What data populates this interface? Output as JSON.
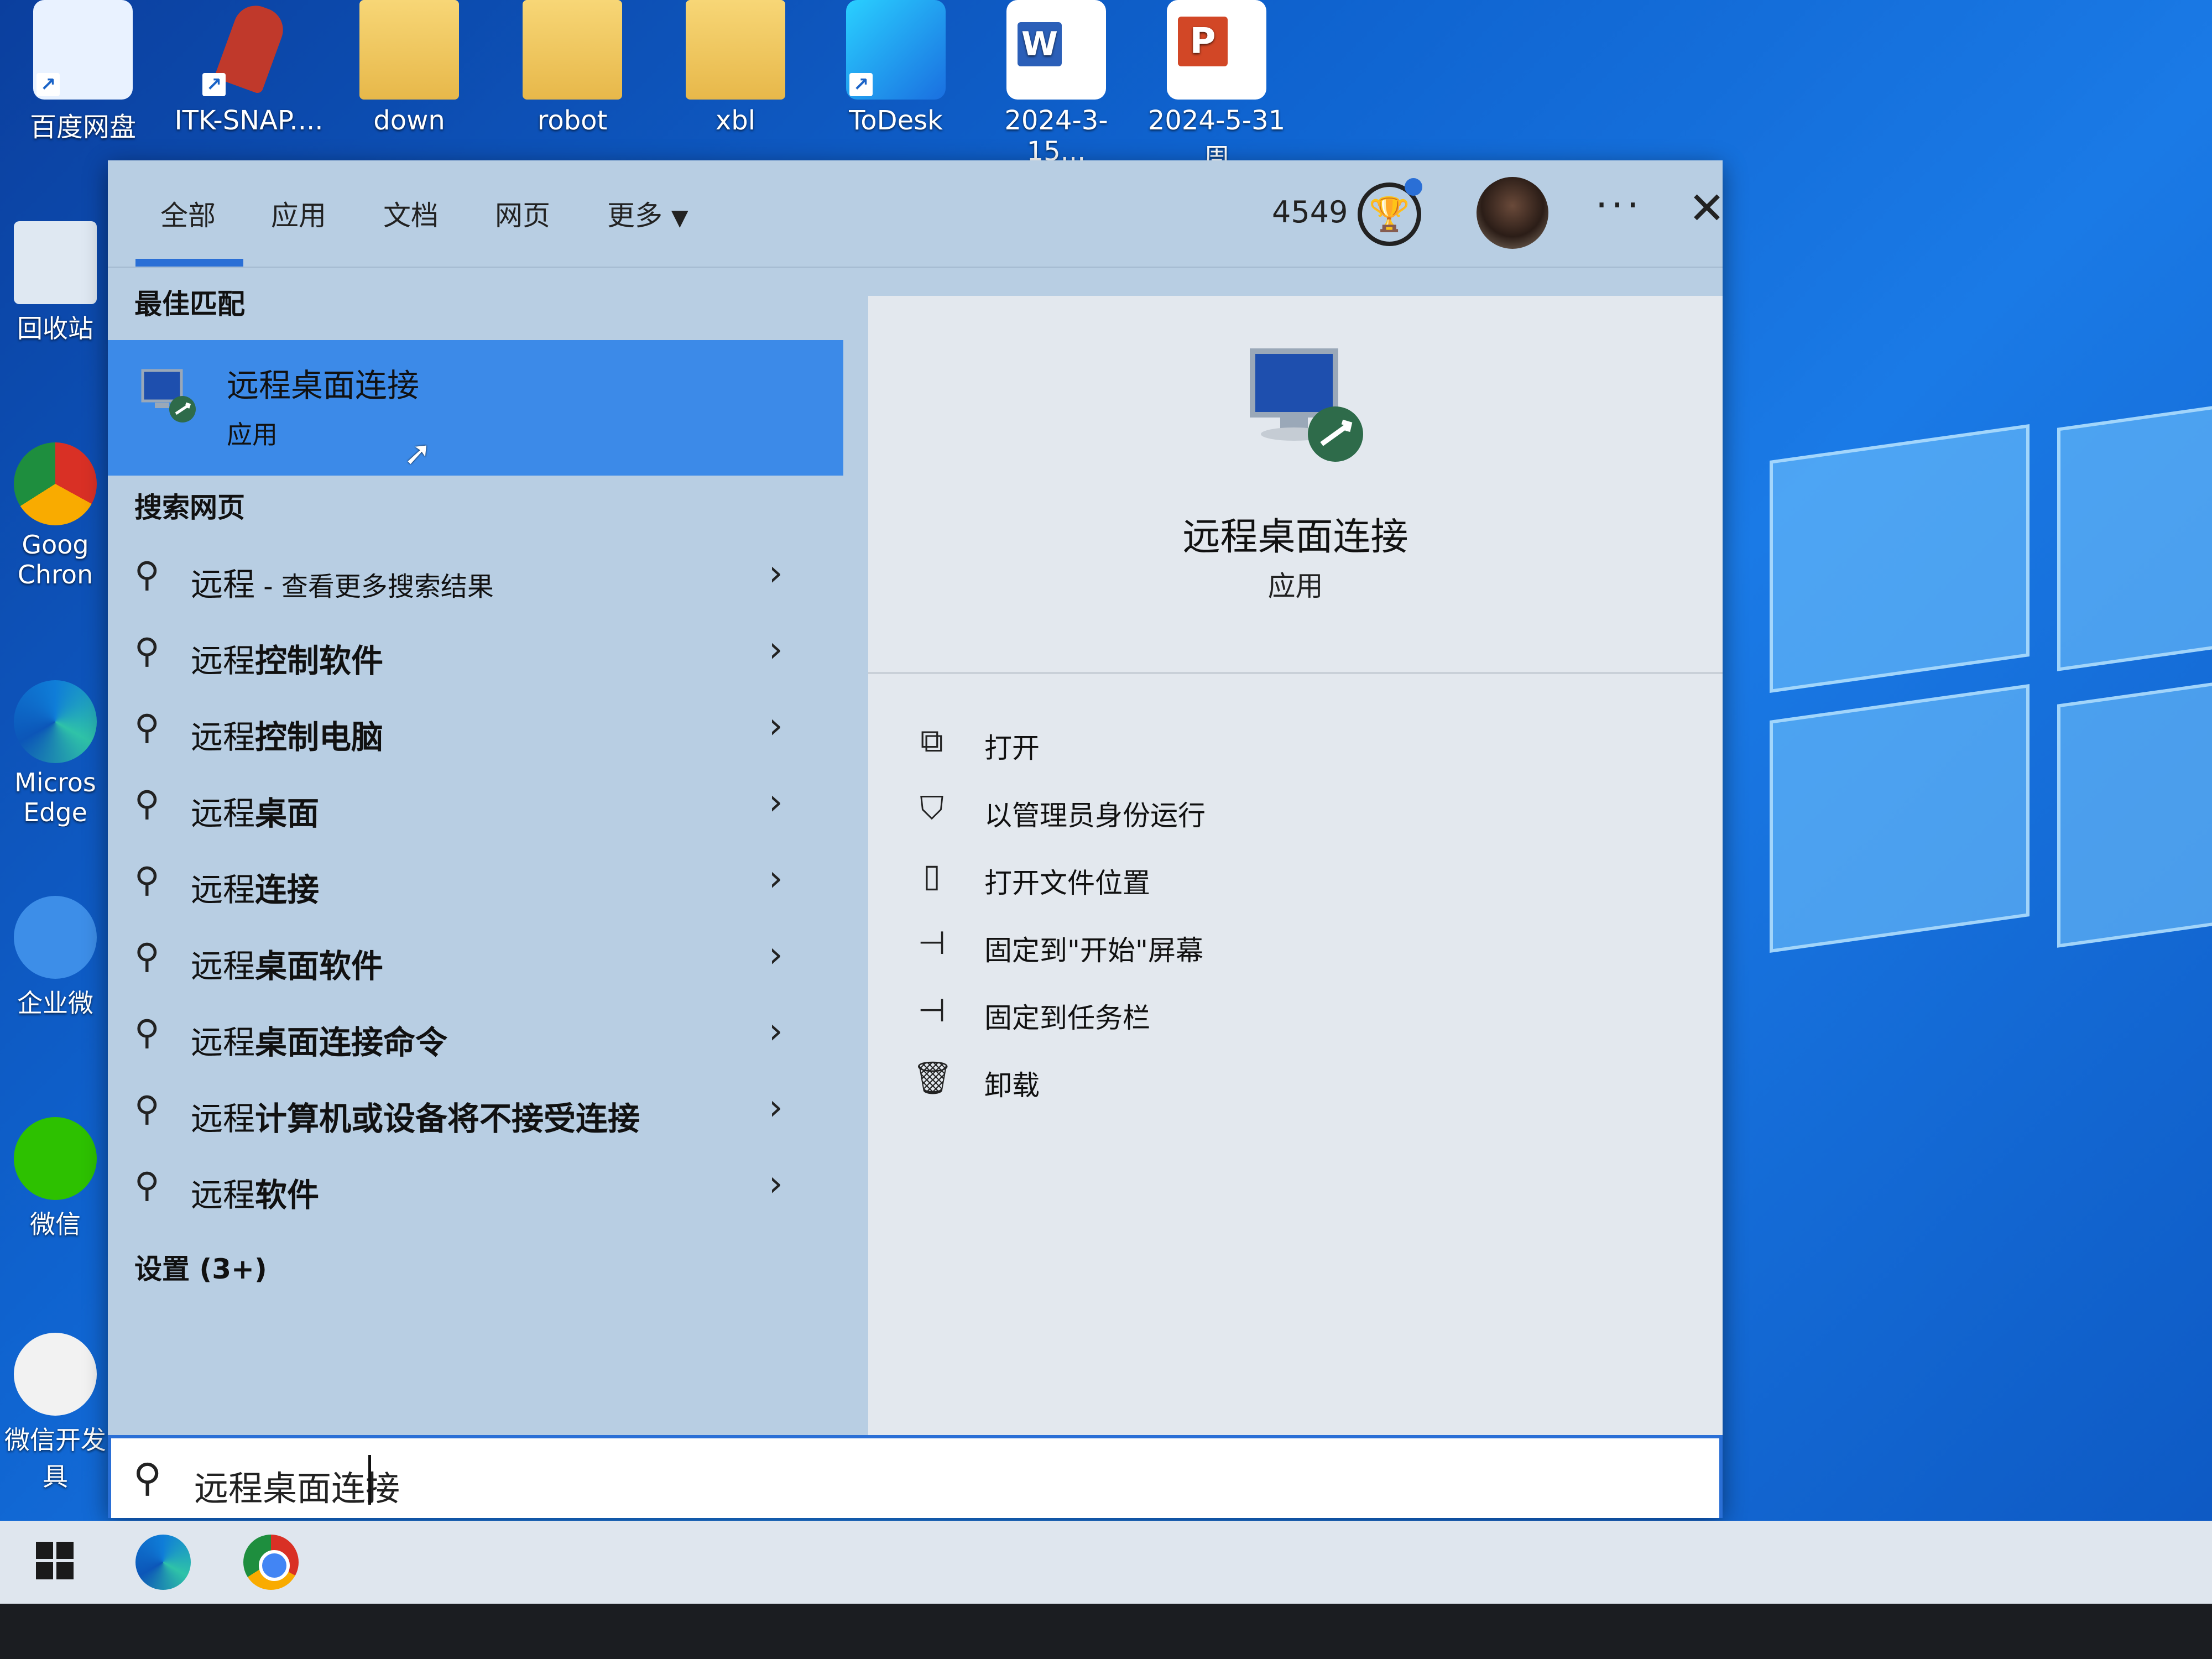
{
  "desktop": {
    "top_icons": [
      {
        "label": "百度网盘"
      },
      {
        "label": "ITK-SNAP...."
      },
      {
        "label": "down"
      },
      {
        "label": "robot"
      },
      {
        "label": "xbl"
      },
      {
        "label": "ToDesk"
      },
      {
        "label": "2024-3-15..."
      },
      {
        "label": "2024-5-31周"
      }
    ],
    "left_icons": [
      {
        "label": "回收站"
      },
      {
        "label": "Goog Chron"
      },
      {
        "label": "Micros Edge"
      },
      {
        "label": "企业微"
      },
      {
        "label": "微信"
      },
      {
        "label": "微信开发具"
      }
    ]
  },
  "search_panel": {
    "tabs": [
      "全部",
      "应用",
      "文档",
      "网页",
      "更多"
    ],
    "active_tab": "全部",
    "score": "4549",
    "best_match_header": "最佳匹配",
    "best_match": {
      "title": "远程桌面连接",
      "subtitle": "应用"
    },
    "web_header": "搜索网页",
    "web_items": [
      {
        "prefix": "远程",
        "suffix": " - 查看更多搜索结果"
      },
      {
        "prefix": "远程",
        "suffix": "控制软件"
      },
      {
        "prefix": "远程",
        "suffix": "控制电脑"
      },
      {
        "prefix": "远程",
        "suffix": "桌面"
      },
      {
        "prefix": "远程",
        "suffix": "连接"
      },
      {
        "prefix": "远程",
        "suffix": "桌面软件"
      },
      {
        "prefix": "远程",
        "suffix": "桌面连接命令"
      },
      {
        "prefix": "远程",
        "suffix": "计算机或设备将不接受连接"
      },
      {
        "prefix": "远程",
        "suffix": "软件"
      }
    ],
    "settings_header": "设置 (3+)",
    "detail": {
      "name": "远程桌面连接",
      "type": "应用",
      "actions": [
        {
          "icon": "open-icon",
          "label": "打开"
        },
        {
          "icon": "admin-shield-icon",
          "label": "以管理员身份运行"
        },
        {
          "icon": "file-location-icon",
          "label": "打开文件位置"
        },
        {
          "icon": "pin-icon",
          "label": "固定到\"开始\"屏幕"
        },
        {
          "icon": "pin-icon",
          "label": "固定到任务栏"
        },
        {
          "icon": "trash-icon",
          "label": "卸载"
        }
      ]
    }
  },
  "search_box": {
    "query": "远程桌面连接"
  },
  "colors": {
    "accent": "#2a6fd6",
    "selection": "#3c8ae8",
    "panel_bg": "#b8cee3",
    "detail_bg": "#e3e8ee"
  }
}
